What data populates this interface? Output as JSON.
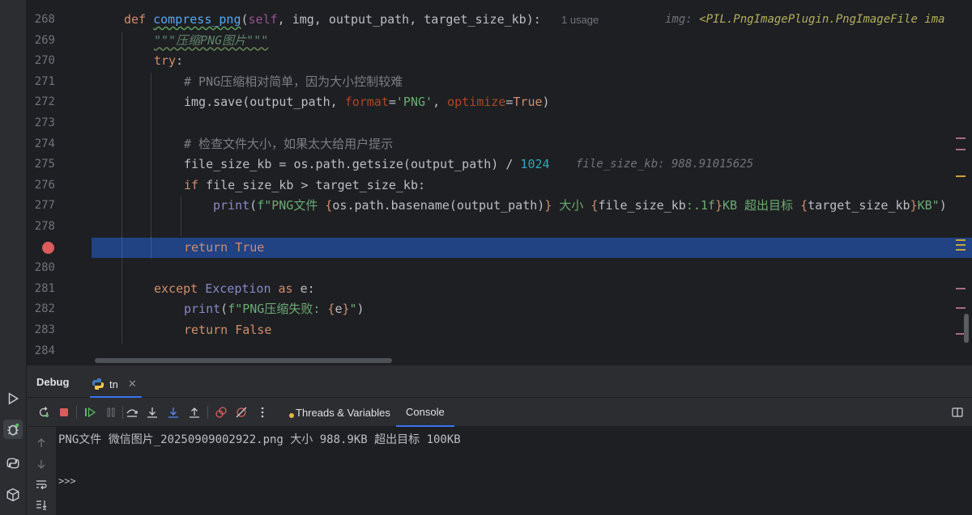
{
  "editor": {
    "lines": [
      {
        "num": "268"
      },
      {
        "num": "269"
      },
      {
        "num": "270"
      },
      {
        "num": "271"
      },
      {
        "num": "272"
      },
      {
        "num": "273"
      },
      {
        "num": "274"
      },
      {
        "num": "275"
      },
      {
        "num": "276"
      },
      {
        "num": "277"
      },
      {
        "num": "278"
      },
      {
        "num": ""
      },
      {
        "num": "280"
      },
      {
        "num": "281"
      },
      {
        "num": "282"
      },
      {
        "num": "283"
      },
      {
        "num": "284"
      }
    ],
    "l268": {
      "def": "def ",
      "fname": "compress_png",
      "p1": "(",
      "self": "self",
      "rest": ", img, output_path, target_size_kb):",
      "usage": "1 usage",
      "hint_name": "img: ",
      "hint_type": "<PIL.PngImagePlugin.PngImageFile ima"
    },
    "l269": {
      "doc": "\"\"\"压缩PNG图片\"\"\""
    },
    "l270": {
      "kw": "try",
      "rest": ":"
    },
    "l271": {
      "comment": "# PNG压缩相对简单，因为大小控制较难"
    },
    "l272": {
      "a": "img.save(output_path, ",
      "p1": "format",
      "eq": "=",
      "s1": "'PNG'",
      "c": ", ",
      "p2": "optimize",
      "eq2": "=",
      "t": "True",
      "end": ")"
    },
    "l274": {
      "comment": "# 检查文件大小，如果太大给用户提示"
    },
    "l275": {
      "a": "file_size_kb = os.path.getsize(output_path) / ",
      "num": "1024",
      "inline": "file_size_kb: 988.91015625"
    },
    "l276": {
      "kw": "if",
      "rest": " file_size_kb > target_size_kb:"
    },
    "l277": {
      "fn": "print",
      "p": "(",
      "f": "f\"PNG文件 ",
      "b1": "{",
      "e1": "os.path.basename(output_path)",
      "b2": "}",
      "s2": " 大小 ",
      "b3": "{",
      "e2": "file_size_kb",
      "fmt": ":.1f",
      "b4": "}",
      "s3": "KB 超出目标 ",
      "b5": "{",
      "e3": "target_size_kb",
      "b6": "}",
      "s4": "KB\"",
      "end": ")"
    },
    "l279": {
      "kw": "return",
      "val": " True"
    },
    "l281": {
      "kw": "except",
      "cls": " Exception",
      "as": " as",
      "rest": " e:"
    },
    "l282": {
      "fn": "print",
      "p": "(",
      "f": "f\"PNG压缩失败: ",
      "b1": "{",
      "e": "e",
      "b2": "}",
      "s": "\"",
      "end": ")"
    },
    "l283": {
      "kw": "return",
      "val": " False"
    }
  },
  "debug": {
    "title": "Debug",
    "session_tab": "tn",
    "tab_threads": "Threads & Variables",
    "tab_console": "Console",
    "console_output": "PNG文件 微信图片_20250909002922.png 大小 988.9KB 超出目标 100KB",
    "prompt": ">>>"
  },
  "colors": {
    "accent": "#3574f0",
    "breakpoint": "#db5c5c",
    "highlight": "#214283"
  }
}
